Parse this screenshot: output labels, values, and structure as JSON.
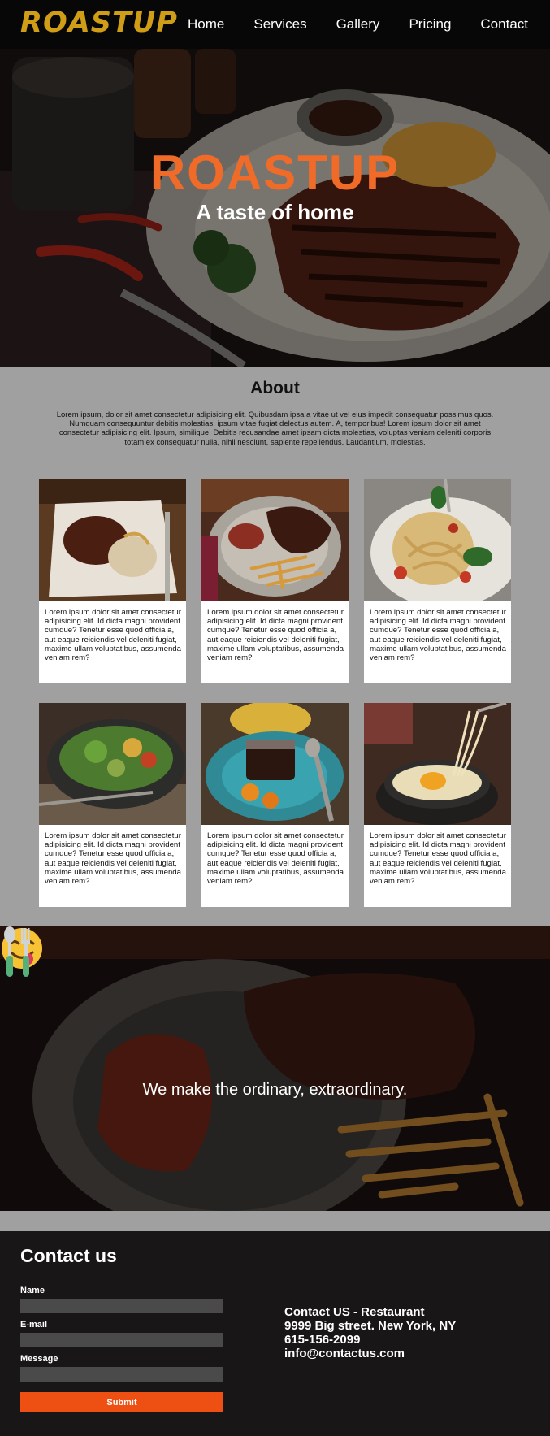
{
  "nav": {
    "logo": "ROASTUP",
    "links": [
      "Home",
      "Services",
      "Gallery",
      "Pricing",
      "Contact"
    ]
  },
  "hero": {
    "title": "ROASTUP",
    "subtitle": "A taste of home"
  },
  "about": {
    "title": "About",
    "text": "Lorem ipsum, dolor sit amet consectetur adipisicing elit. Quibusdam ipsa a vitae ut vel eius impedit consequatur possimus quos. Numquam consequuntur debitis molestias, ipsum vitae fugiat delectus autem. A, temporibus! Lorem ipsum dolor sit amet consectetur adipisicing elit. Ipsum, similique. Debitis recusandae amet ipsam dicta molestias, voluptas veniam deleniti corporis totam ex consequatur nulla, nihil nesciunt, sapiente repellendus. Laudantium, molestias."
  },
  "cards": [
    {
      "text": "Lorem ipsum dolor sit amet consectetur adipisicing elit. Id dicta magni provident cumque? Tenetur esse quod officia a, aut eaque reiciendis vel deleniti fugiat, maxime ullam voluptatibus, assumenda veniam rem?"
    },
    {
      "text": "Lorem ipsum dolor sit amet consectetur adipisicing elit. Id dicta magni provident cumque? Tenetur esse quod officia a, aut eaque reiciendis vel deleniti fugiat, maxime ullam voluptatibus, assumenda veniam rem?"
    },
    {
      "text": "Lorem ipsum dolor sit amet consectetur adipisicing elit. Id dicta magni provident cumque? Tenetur esse quod officia a, aut eaque reiciendis vel deleniti fugiat, maxime ullam voluptatibus, assumenda veniam rem?"
    },
    {
      "text": "Lorem ipsum dolor sit amet consectetur adipisicing elit. Id dicta magni provident cumque? Tenetur esse quod officia a, aut eaque reiciendis vel deleniti fugiat, maxime ullam voluptatibus, assumenda veniam rem?"
    },
    {
      "text": "Lorem ipsum dolor sit amet consectetur adipisicing elit. Id dicta magni provident cumque? Tenetur esse quod officia a, aut eaque reiciendis vel deleniti fugiat, maxime ullam voluptatibus, assumenda veniam rem?"
    },
    {
      "text": "Lorem ipsum dolor sit amet consectetur adipisicing elit. Id dicta magni provident cumque? Tenetur esse quod officia a, aut eaque reiciendis vel deleniti fugiat, maxime ullam voluptatibus, assumenda veniam rem?"
    }
  ],
  "banner": {
    "icons": [
      "face-savoring-food-icon",
      "fork-and-spoon-icon"
    ],
    "text": "We make the ordinary, extraordinary."
  },
  "contact": {
    "title": "Contact us",
    "name_label": "Name",
    "email_label": "E-mail",
    "message_label": "Message",
    "submit_label": "Submit",
    "info_title": "Contact US - Restaurant",
    "address": "9999 Big street. New York, NY",
    "phone": "615-156-2099",
    "email": "info@contactus.com"
  },
  "colors": {
    "logo": "#cf9d16",
    "accent": "#f06a28",
    "submit": "#ee4f12",
    "section_bg": "#a0a0a0",
    "footer_bg": "#181616"
  }
}
